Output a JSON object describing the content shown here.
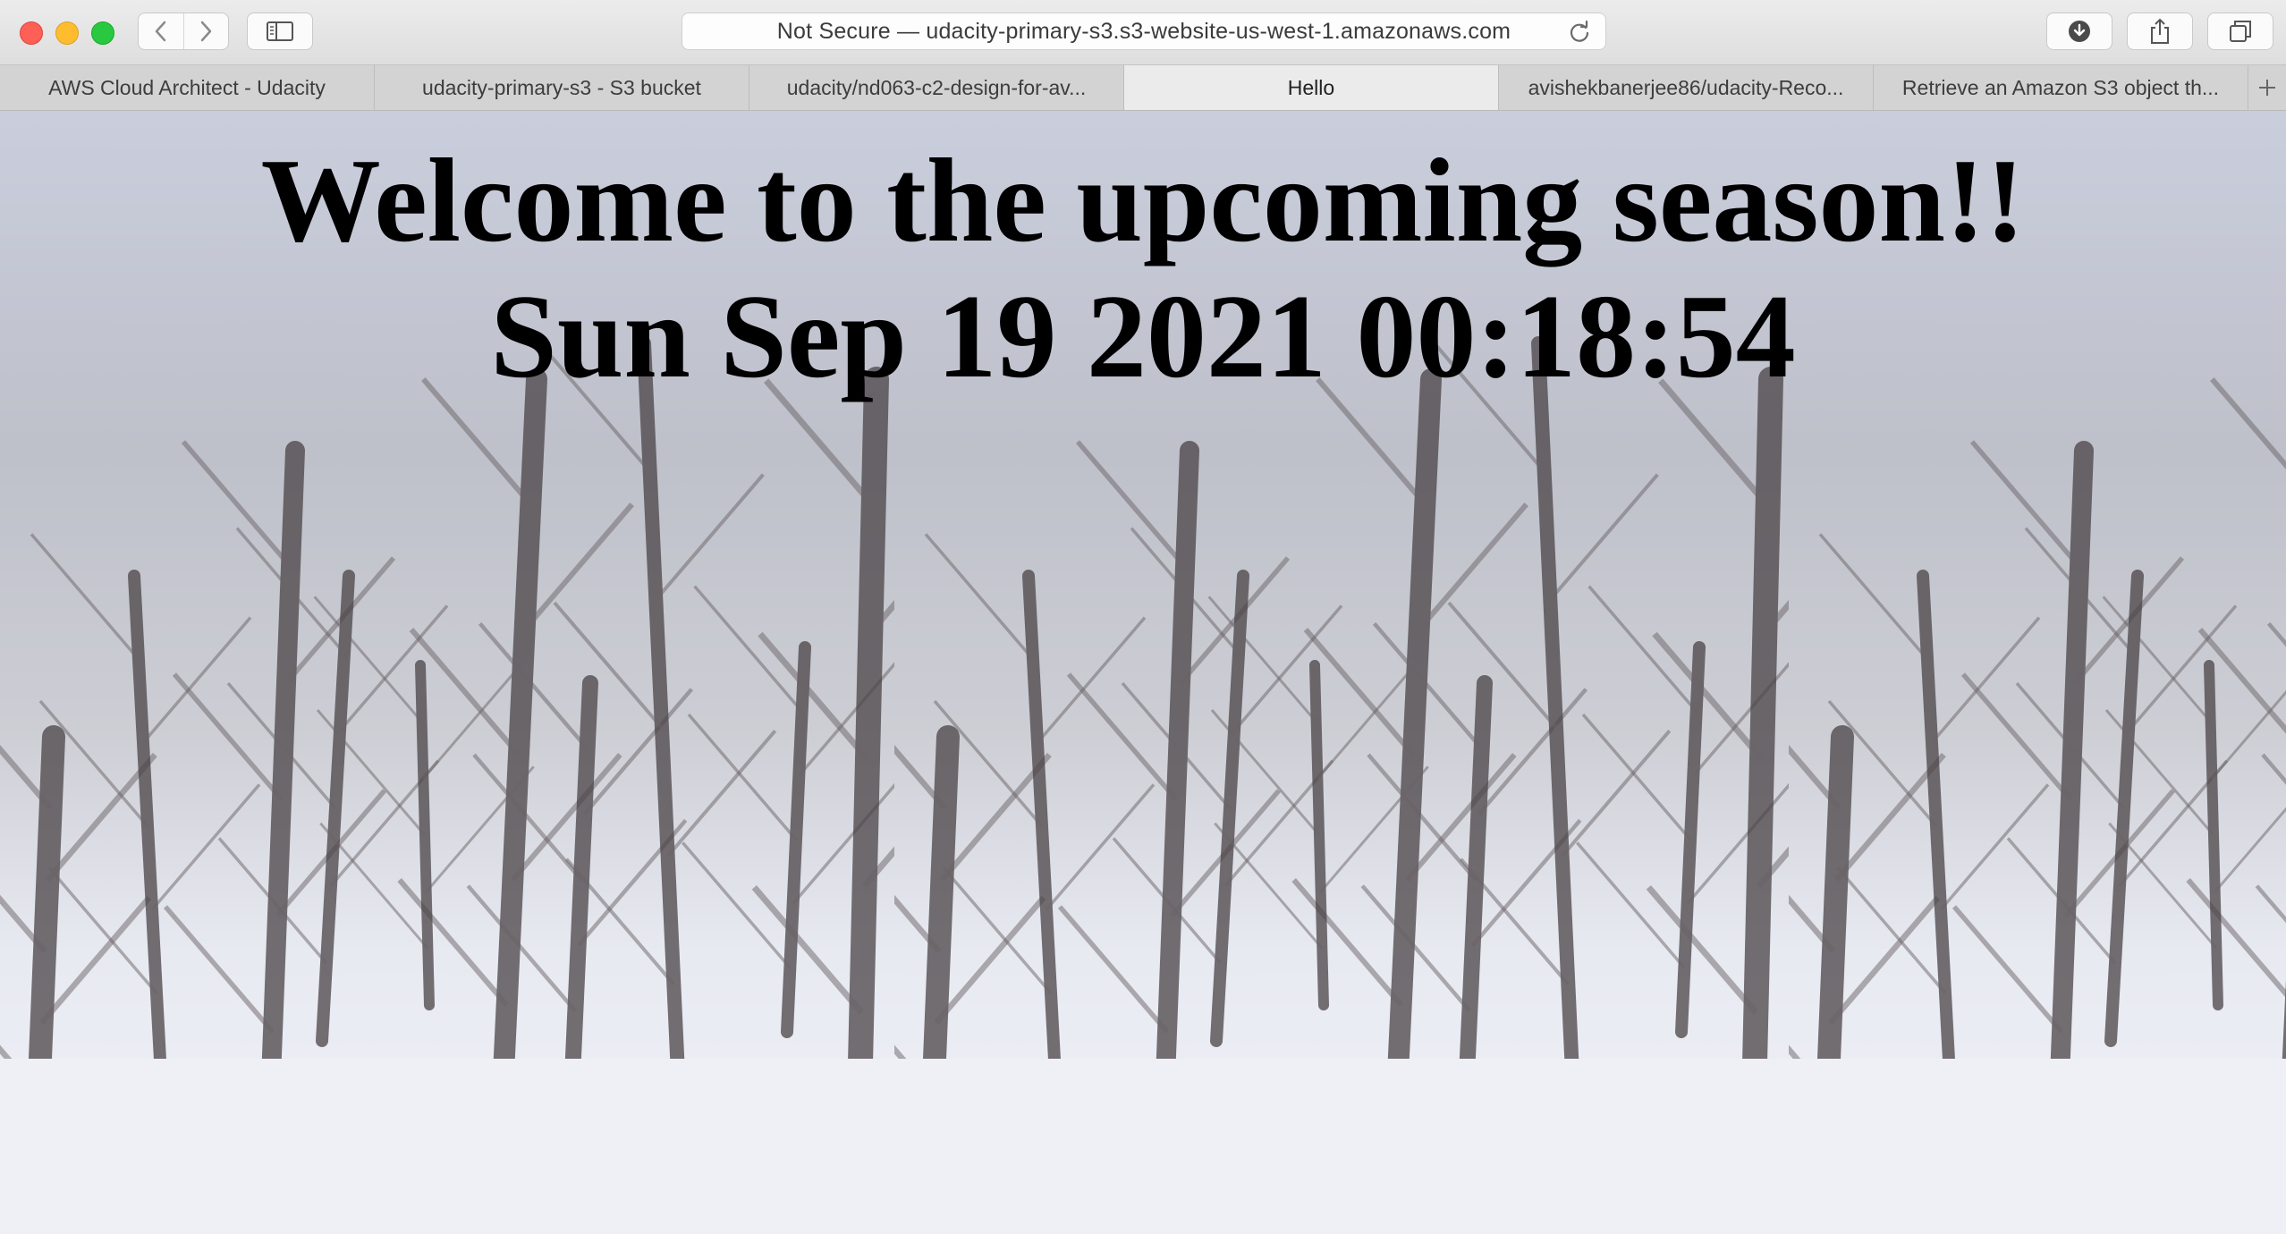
{
  "window": {
    "address": "Not Secure — udacity-primary-s3.s3-website-us-west-1.amazonaws.com"
  },
  "tabs": [
    {
      "label": "AWS Cloud Architect - Udacity",
      "active": false
    },
    {
      "label": "udacity-primary-s3 - S3 bucket",
      "active": false
    },
    {
      "label": "udacity/nd063-c2-design-for-av...",
      "active": false
    },
    {
      "label": "Hello",
      "active": true
    },
    {
      "label": "avishekbanerjee86/udacity-Reco...",
      "active": false
    },
    {
      "label": "Retrieve an Amazon S3 object th...",
      "active": false
    }
  ],
  "page": {
    "heading": "Welcome to the upcoming season!!",
    "datetime": "Sun Sep 19 2021 00:18:54"
  },
  "icons": {
    "back": "chevron-left-icon",
    "forward": "chevron-right-icon",
    "sidebar": "sidebar-icon",
    "reload": "reload-icon",
    "download": "download-icon",
    "share": "share-icon",
    "tabs": "tabs-overview-icon",
    "new_tab": "plus-icon"
  },
  "colors": {
    "close": "#fe5f57",
    "minimize": "#febc2e",
    "zoom": "#28c840"
  }
}
